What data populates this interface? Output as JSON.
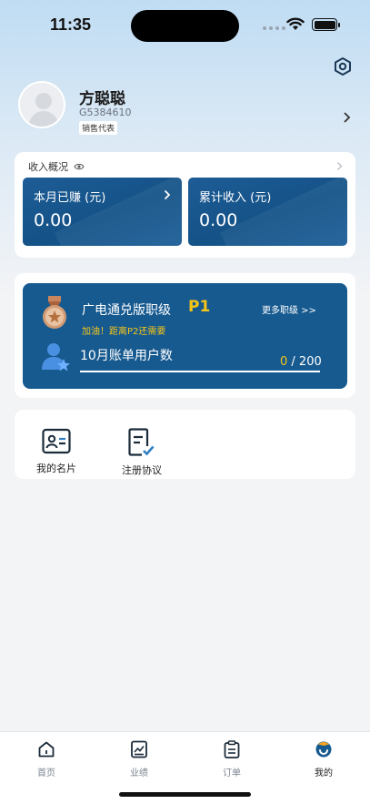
{
  "status_bar": {
    "time": "11:35"
  },
  "profile": {
    "name": "方聪聪",
    "id": "G5384610",
    "role": "销售代表"
  },
  "income": {
    "title": "收入概况",
    "month_label": "本月已赚 (元)",
    "month_value": "0.00",
    "total_label": "累计收入 (元)",
    "total_value": "0.00"
  },
  "rank": {
    "title": "广电通兑版职级",
    "level": "P1",
    "more": "更多职级 >>",
    "hint": "加油！距离P2还需要",
    "users_label": "10月账单用户数",
    "progress_current": "0",
    "progress_total": "/ 200",
    "progress_fraction": 0
  },
  "shortcuts": [
    {
      "label": "我的名片",
      "icon": "id-card-icon"
    },
    {
      "label": "注册协议",
      "icon": "agreement-check-icon"
    }
  ],
  "tabs": [
    {
      "label": "首页",
      "icon": "home-icon"
    },
    {
      "label": "业绩",
      "icon": "performance-chart-icon"
    },
    {
      "label": "订单",
      "icon": "clipboard-icon"
    },
    {
      "label": "我的",
      "icon": "profile-face-icon",
      "active": true
    }
  ],
  "colors": {
    "primary": "#175a90",
    "accent": "#f5c518",
    "background": "#f3f4f6"
  }
}
